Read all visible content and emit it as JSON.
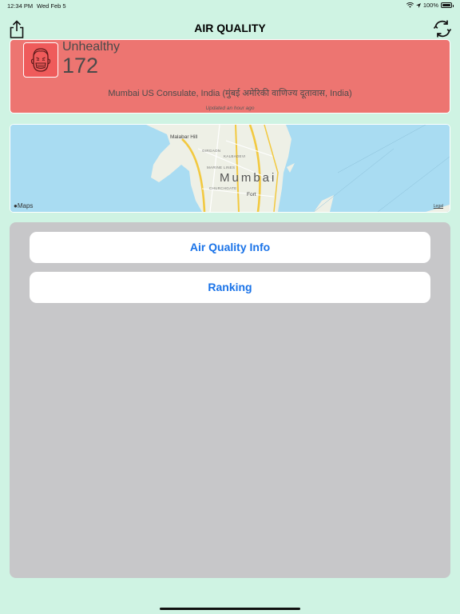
{
  "status_bar": {
    "time": "12:34 PM",
    "date": "Wed Feb 5",
    "battery": "100%",
    "battery_level": 1.0
  },
  "nav": {
    "title": "AIR QUALITY",
    "share_icon": "share-icon",
    "refresh_icon": "refresh-icon"
  },
  "aqi": {
    "category": "Unhealthy",
    "value": "172",
    "station": "Mumbai US Consulate, India (मुंबई अमेरिकी वाणिज्य दूतावास, India)",
    "updated": "Updated an hour ago",
    "card_color": "#ed7571",
    "face_icon": "face-mask-icon"
  },
  "map": {
    "city": "Mumbai",
    "places": {
      "malabar": "Malabar Hill",
      "girgaon": "GIRGAON",
      "kalbadevi": "KALBADEVI",
      "marine": "MARINE LINES",
      "church": "CHURCHGATE",
      "fort": "Fort"
    },
    "brand": "Maps",
    "legal": "Legal"
  },
  "menu": {
    "buttons": [
      {
        "label": "Air Quality Info"
      },
      {
        "label": "Ranking"
      }
    ]
  },
  "colors": {
    "background": "#cff3e3",
    "accent": "#1a73e8",
    "panel": "#c7c7c9"
  }
}
